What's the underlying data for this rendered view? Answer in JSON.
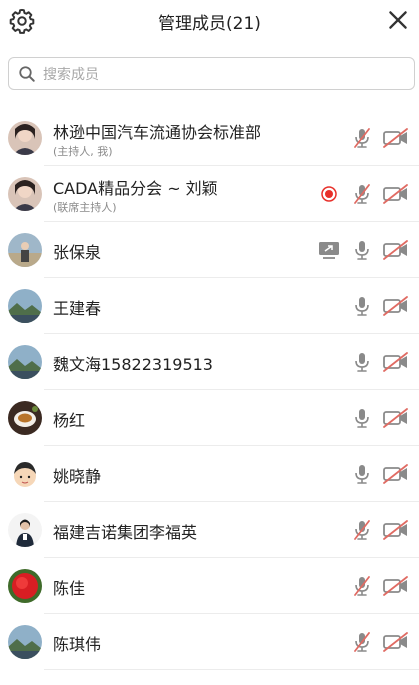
{
  "header": {
    "title": "管理成员(21)",
    "settings_icon": "gear-icon",
    "close_icon": "close-icon"
  },
  "search": {
    "placeholder": "搜索成员",
    "value": ""
  },
  "colors": {
    "mic_muted": "#e06b63",
    "cam_off": "#e06b63",
    "icon_gray": "#888888",
    "record_red": "#e8302a"
  },
  "members": [
    {
      "name": "林逊中国汽车流通协会标准部",
      "role": "(主持人, 我)",
      "mic": "muted",
      "camera": "off",
      "recording": false,
      "sharing": false,
      "avatar": "woman-portrait"
    },
    {
      "name": "CADA精品分会 ~ 刘颖",
      "role": "(联席主持人)",
      "mic": "muted",
      "camera": "off",
      "recording": true,
      "sharing": false,
      "avatar": "woman-portrait"
    },
    {
      "name": "张保泉",
      "role": "",
      "mic": "on",
      "camera": "off",
      "recording": false,
      "sharing": true,
      "avatar": "outdoor-photo"
    },
    {
      "name": "王建春",
      "role": "",
      "mic": "on",
      "camera": "off",
      "recording": false,
      "sharing": false,
      "avatar": "landscape"
    },
    {
      "name": "魏文海15822319513",
      "role": "",
      "mic": "on",
      "camera": "off",
      "recording": false,
      "sharing": false,
      "avatar": "landscape"
    },
    {
      "name": "杨红",
      "role": "",
      "mic": "on",
      "camera": "off",
      "recording": false,
      "sharing": false,
      "avatar": "tea-cup"
    },
    {
      "name": "姚晓静",
      "role": "",
      "mic": "on",
      "camera": "off",
      "recording": false,
      "sharing": false,
      "avatar": "cartoon-face"
    },
    {
      "name": " 福建吉诺集团李福英",
      "role": "",
      "mic": "muted",
      "camera": "off",
      "recording": false,
      "sharing": false,
      "avatar": "person-photo"
    },
    {
      "name": "陈佳",
      "role": "",
      "mic": "muted",
      "camera": "off",
      "recording": false,
      "sharing": false,
      "avatar": "red-flower"
    },
    {
      "name": "陈琪伟",
      "role": "",
      "mic": "muted",
      "camera": "off",
      "recording": false,
      "sharing": false,
      "avatar": "landscape"
    }
  ]
}
